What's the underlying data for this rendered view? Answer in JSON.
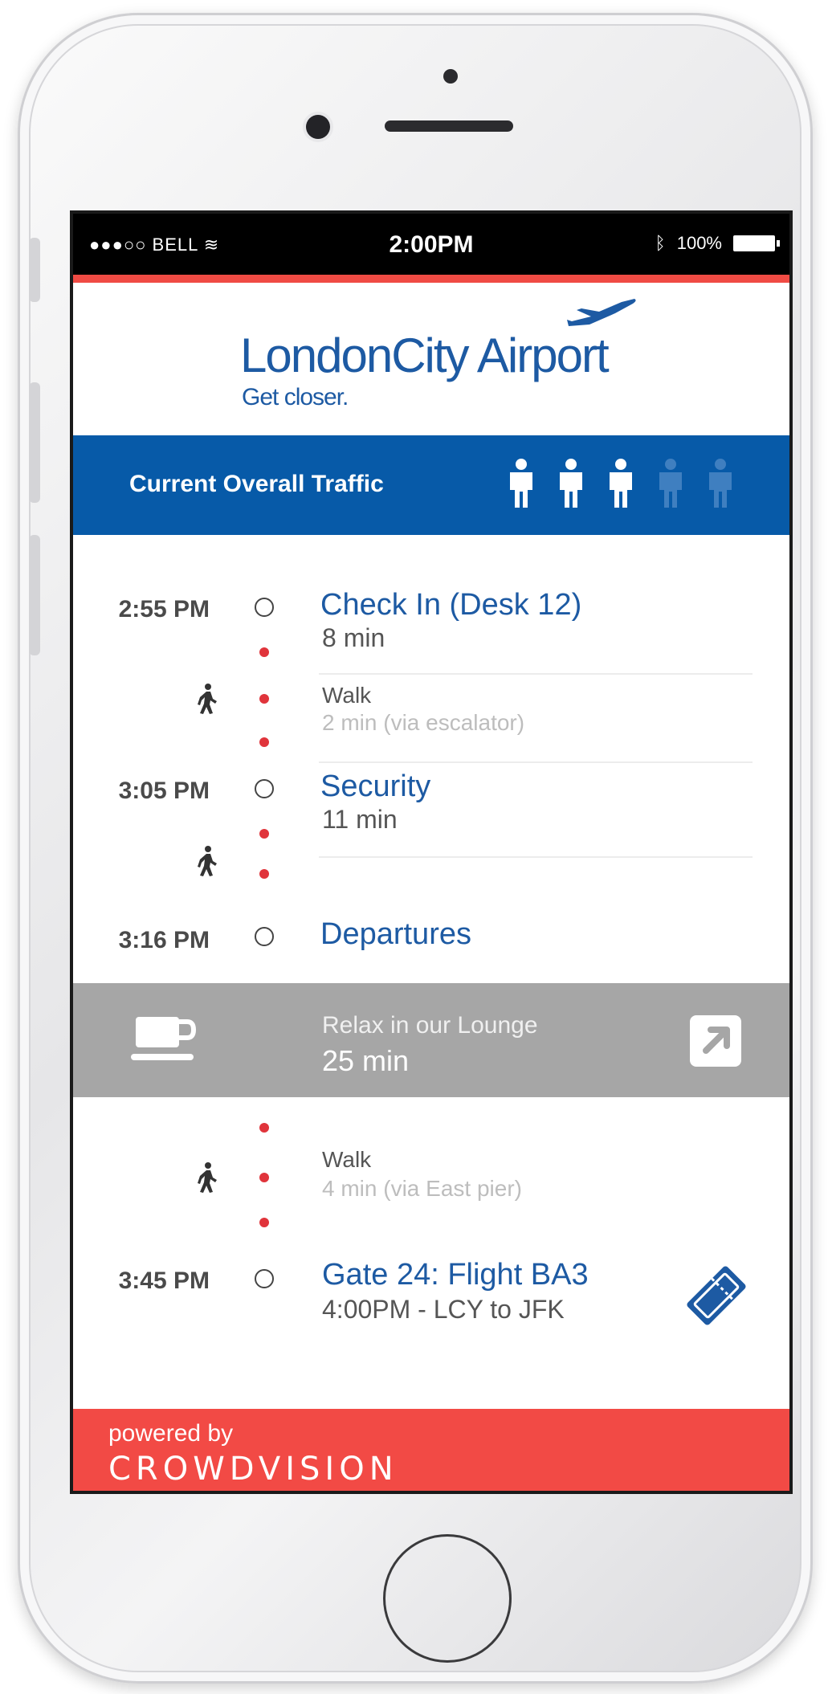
{
  "status_bar": {
    "carrier": "●●●○○ BELL",
    "time": "2:00PM",
    "battery": "100%"
  },
  "logo": {
    "name_part1": "London",
    "name_part2": "City Airport",
    "tagline": "Get closer."
  },
  "traffic": {
    "label": "Current Overall Traffic",
    "level": 3,
    "max_level": 5
  },
  "timeline": {
    "checkin": {
      "time": "2:55 PM",
      "title": "Check In (Desk 12)",
      "duration": "8 min"
    },
    "walk1": {
      "label": "Walk",
      "detail": "2 min (via escalator)"
    },
    "security": {
      "time": "3:05 PM",
      "title": "Security",
      "duration": "11 min"
    },
    "departures": {
      "time": "3:16 PM",
      "title": "Departures"
    },
    "lounge": {
      "title": "Relax in our Lounge",
      "duration": "25 min"
    },
    "walk2": {
      "label": "Walk",
      "detail": "4 min (via East pier)"
    },
    "gate": {
      "time": "3:45 PM",
      "title": "Gate 24: Flight BA3",
      "detail": "4:00PM  - LCY to JFK"
    }
  },
  "footer": {
    "powered_by": "powered by",
    "brand": "CROWDVISION"
  },
  "colors": {
    "accent_blue": "#075aa8",
    "accent_red": "#f24a45",
    "lounge_gray": "#a6a6a6"
  }
}
